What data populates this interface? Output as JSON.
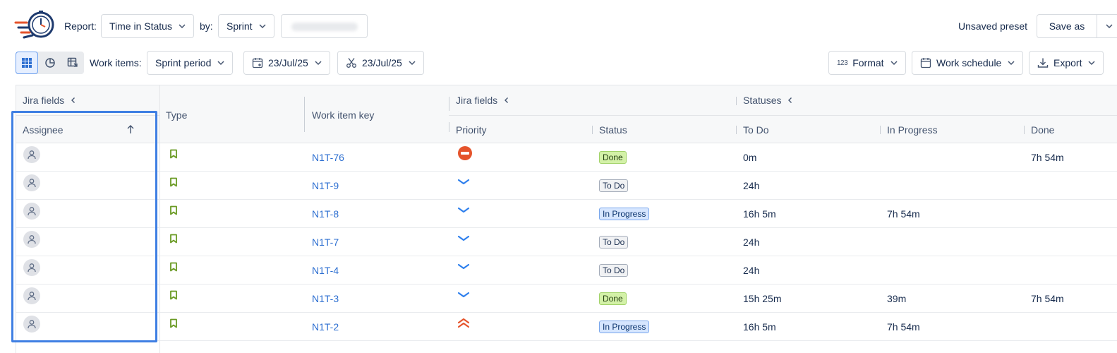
{
  "toolbar": {
    "report_label": "Report:",
    "report_value": "Time in Status",
    "by_label": "by:",
    "by_value": "Sprint",
    "preset_status": "Unsaved preset",
    "save_as_label": "Save as",
    "work_items_label": "Work items:",
    "work_items_value": "Sprint period",
    "start_date": "23/Jul/25",
    "end_date": "23/Jul/25",
    "format_label": "Format",
    "work_schedule_label": "Work schedule",
    "export_label": "Export"
  },
  "table": {
    "group_headers": {
      "left_jira_fields": "Jira fields",
      "jira_fields": "Jira fields",
      "statuses": "Statuses"
    },
    "columns": {
      "assignee": "Assignee",
      "type": "Type",
      "work_item_key": "Work item key",
      "priority": "Priority",
      "status": "Status",
      "to_do": "To Do",
      "in_progress": "In Progress",
      "done": "Done"
    },
    "sort_column": "assignee",
    "sort_direction": "ascending",
    "rows": [
      {
        "key": "N1T-76",
        "priority": "highest-blocker",
        "status": "Done",
        "status_kind": "done",
        "to_do": "0m",
        "in_progress": "",
        "done": "7h 54m"
      },
      {
        "key": "N1T-9",
        "priority": "low",
        "status": "To Do",
        "status_kind": "todo",
        "to_do": "24h",
        "in_progress": "",
        "done": ""
      },
      {
        "key": "N1T-8",
        "priority": "low",
        "status": "In Progress",
        "status_kind": "prog",
        "to_do": "16h 5m",
        "in_progress": "7h 54m",
        "done": ""
      },
      {
        "key": "N1T-7",
        "priority": "low",
        "status": "To Do",
        "status_kind": "todo",
        "to_do": "24h",
        "in_progress": "",
        "done": ""
      },
      {
        "key": "N1T-4",
        "priority": "low",
        "status": "To Do",
        "status_kind": "todo",
        "to_do": "24h",
        "in_progress": "",
        "done": ""
      },
      {
        "key": "N1T-3",
        "priority": "low",
        "status": "Done",
        "status_kind": "done",
        "to_do": "15h 25m",
        "in_progress": "39m",
        "done": "7h 54m"
      },
      {
        "key": "N1T-2",
        "priority": "highest",
        "status": "In Progress",
        "status_kind": "prog",
        "to_do": "16h 5m",
        "in_progress": "7h 54m",
        "done": ""
      }
    ]
  },
  "icons": {
    "type": "story-bookmark-icon",
    "assignee": "default-avatar-icon"
  },
  "colors": {
    "link": "#2d6fd1",
    "highlight": "#3f7fe3",
    "story_green": "#6a9a23",
    "priority_low": "#2f80ed",
    "priority_high": "#e5532b"
  }
}
